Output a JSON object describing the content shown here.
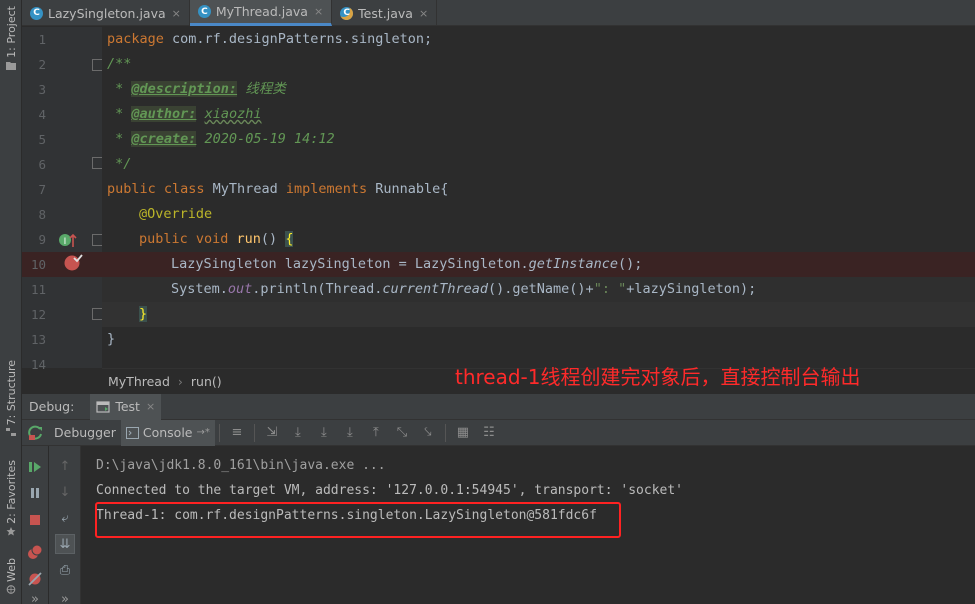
{
  "tabs": [
    {
      "icon": "C",
      "label": "LazySingleton.java",
      "close": "×"
    },
    {
      "icon": "C",
      "label": "MyThread.java",
      "close": "×"
    },
    {
      "icon": "C",
      "label": "Test.java",
      "close": "×"
    }
  ],
  "left_stripe": {
    "project": "1: Project",
    "structure": "7: Structure",
    "favorites": "2: Favorites",
    "web": "Web"
  },
  "gutter": {
    "line_numbers": [
      "1",
      "2",
      "3",
      "4",
      "5",
      "6",
      "7",
      "8",
      "9",
      "10",
      "11",
      "12",
      "13",
      "14"
    ]
  },
  "code": {
    "l1_kw": "package",
    "l1_rest": " com.rf.designPatterns.singleton;",
    "l2": "/**",
    "l3_pre": " * ",
    "l3_tag": "@description:",
    "l3_text": " 线程类",
    "l4_pre": " * ",
    "l4_tag": "@author:",
    "l4_text": "xiaozhi",
    "l5_pre": " * ",
    "l5_tag": "@create:",
    "l5_text": " 2020-05-19 14:12",
    "l6": " */",
    "l7_kw1": "public class",
    "l7_name": " MyThread ",
    "l7_kw2": "implements",
    "l7_rest": " Runnable{",
    "l8": "@Override",
    "l9_kw": "public void",
    "l9_fn": " run",
    "l9_rest": "() ",
    "l9_brace": "{",
    "l10_a": "LazySingleton lazySingleton = LazySingleton.",
    "l10_b": "getInstance",
    "l10_c": "();",
    "l11_a": "System.",
    "l11_b": "out",
    "l11_c": ".println(Thread.",
    "l11_d": "currentThread",
    "l11_e": "().getName()+",
    "l11_f": "\": \"",
    "l11_g": "+lazySingleton);",
    "l12": "}",
    "l13": "}"
  },
  "breadcrumb": {
    "class": "MyThread",
    "sep": "›",
    "method": "run()"
  },
  "annotation": "thread-1线程创建完对象后，直接控制台输出",
  "debug": {
    "label": "Debug:",
    "tab": "Test",
    "tab_close": "×",
    "debugger_tab": "Debugger",
    "console_tab": "Console",
    "console_arrow": "→*"
  },
  "console": {
    "lines": [
      "D:\\java\\jdk1.8.0_161\\bin\\java.exe ...",
      "Connected to the target VM, address: '127.0.0.1:54945', transport: 'socket'",
      "Thread-1: com.rf.designPatterns.singleton.LazySingleton@581fdc6f"
    ]
  },
  "more": "»",
  "colors": {
    "accent": "#4a88c7",
    "annotation": "#ff2a2a",
    "stop": "#c75450",
    "resume": "#59a869"
  }
}
